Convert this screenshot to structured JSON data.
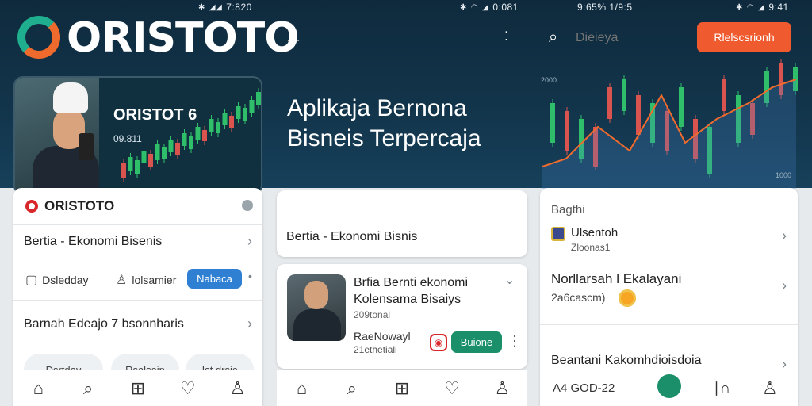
{
  "colors": {
    "accent_teal": "#1a8f6a",
    "accent_blue": "#2f7fd2",
    "accent_orange": "#ef5a2e",
    "brand_red": "#d8262a",
    "dark_bg": "#12344a"
  },
  "panel1": {
    "status_time": "7:820",
    "logo_text": "ORISTOTO",
    "hero": {
      "title": "ORISTOT 6",
      "number": "09.811"
    },
    "brand": "ORISTOTO",
    "row1": "Bertia - Ekonomi Bisenis",
    "actions": {
      "a1": "Dsledday",
      "a2": "lolsamier",
      "button": "Nabaca"
    },
    "row2": "Barnah Edeajo 7 bsonnharis",
    "chips": [
      "Dsrtday",
      "Rsalsaip",
      "Ist drsic"
    ]
  },
  "panel2": {
    "status_time": "0:081",
    "big_title": "Aplikaja Bernona Bisneis Terpercaja",
    "card_a_text": "Bertia - Ekonomi Bisnis",
    "article": {
      "title": "Brfia Bernti ekonomi Kolensama Bisaiys",
      "subtitle": "209tonal",
      "author": "RaeNowayl",
      "count": "21ethetiali",
      "button": "Buione"
    }
  },
  "panel3": {
    "status_time": "9:41",
    "status_center": "9:65% 1/9:5",
    "search_placeholder": "Dieieya",
    "header_button": "Rlelscsrionh",
    "chart_label_top": "2000",
    "chart_label_bottom": "1000",
    "section_label": "Bagthi",
    "item1": {
      "title": "Ulsentoh",
      "sub": "Zloonas1"
    },
    "item2": {
      "title": "Norllarsah l Ekalayani",
      "sub": "2a6cascm)"
    },
    "item3": {
      "title": "Beantani Kakomhdioisdoia"
    },
    "nav_text": "A4 GOD-22"
  },
  "nav_icons": [
    "home-icon",
    "search-icon",
    "plus-icon",
    "heart-icon",
    "profile-icon"
  ]
}
